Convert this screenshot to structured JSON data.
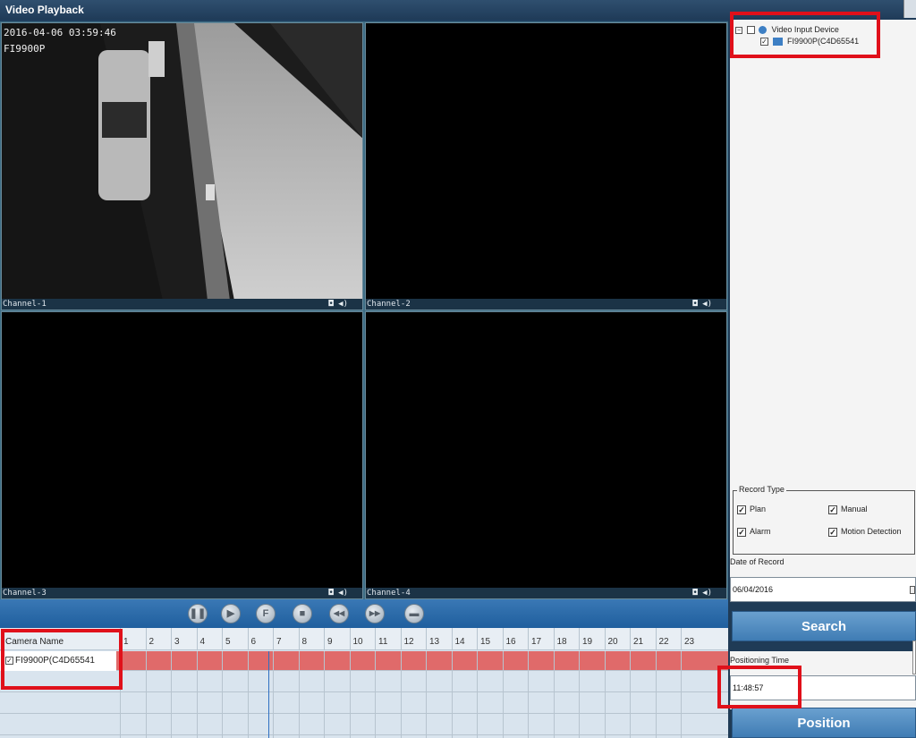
{
  "window": {
    "title": "Video Playback"
  },
  "channels": [
    {
      "label": "Channel-1",
      "osd_time": "2016-04-06 03:59:46",
      "osd_model": "FI9900P"
    },
    {
      "label": "Channel-2"
    },
    {
      "label": "Channel-3"
    },
    {
      "label": "Channel-4"
    }
  ],
  "controls": [
    {
      "name": "pause-button",
      "symbol": "❚❚"
    },
    {
      "name": "play-button",
      "symbol": "▶"
    },
    {
      "name": "fast-forward-button",
      "symbol": "F"
    },
    {
      "name": "stop-button",
      "symbol": "■"
    },
    {
      "name": "rewind-button",
      "symbol": "◀◀"
    },
    {
      "name": "forward-button",
      "symbol": "▶▶"
    },
    {
      "name": "folder-button",
      "symbol": "▬"
    }
  ],
  "timeline": {
    "header": "Camera Name",
    "hours": [
      "1",
      "2",
      "3",
      "4",
      "5",
      "6",
      "7",
      "8",
      "9",
      "10",
      "11",
      "12",
      "13",
      "14",
      "15",
      "16",
      "17",
      "18",
      "19",
      "20",
      "21",
      "22",
      "23"
    ],
    "camera": "FI9900P(C4D65541"
  },
  "tree": {
    "root": "Video Input Device",
    "device": "FI9900P(C4D65541"
  },
  "record_type": {
    "legend": "Record Type",
    "options": [
      {
        "label": "Plan",
        "checked": true
      },
      {
        "label": "Manual",
        "checked": true
      },
      {
        "label": "Alarm",
        "checked": true
      },
      {
        "label": "Motion Detection",
        "checked": true
      }
    ]
  },
  "date": {
    "label": "Date of Record",
    "value": "06/04/2016"
  },
  "search_label": "Search",
  "positioning": {
    "label": "Positioning Time",
    "value": "11:48:57"
  },
  "position_label": "Position",
  "colors": {
    "highlight": "#e0101a",
    "record_bar": "#e06a6a",
    "accent": "#3f7cb4"
  }
}
